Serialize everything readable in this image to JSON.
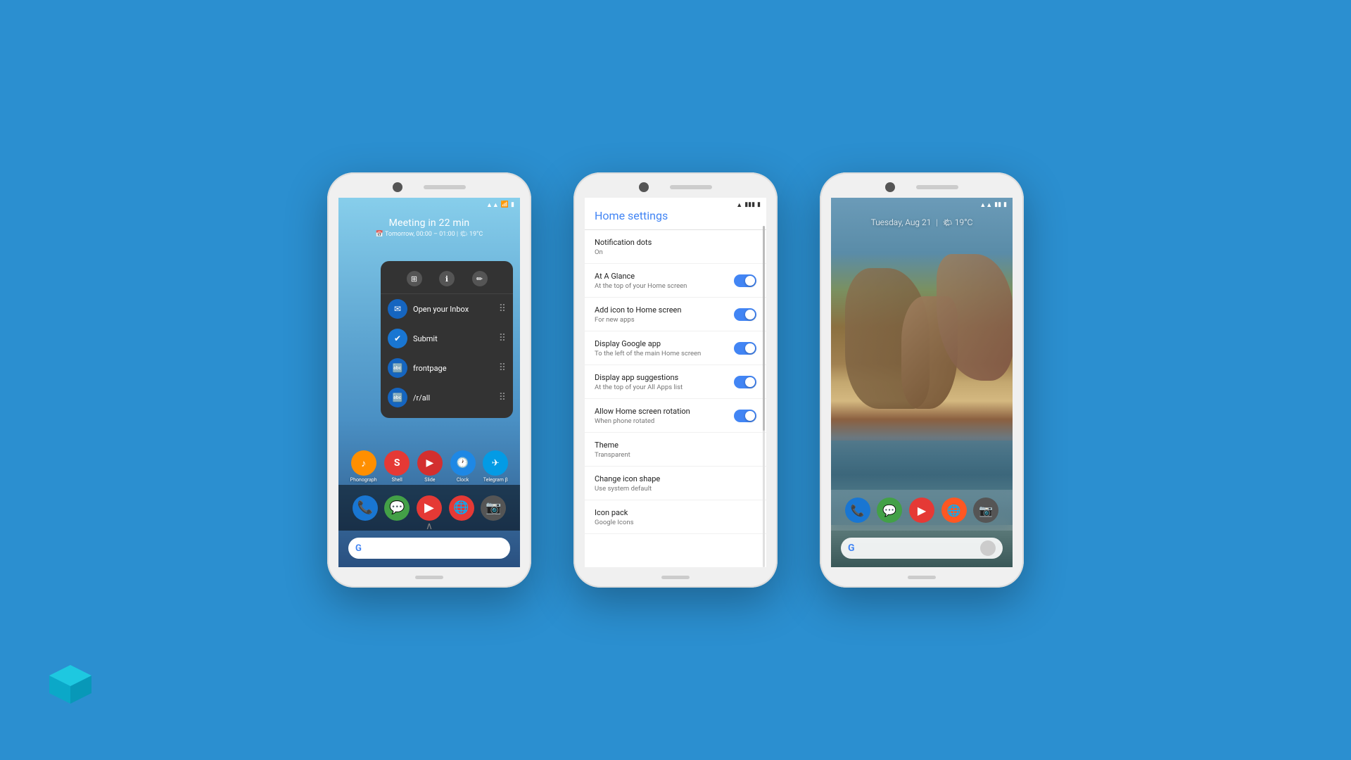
{
  "background": "#2B8FD0",
  "phone1": {
    "at_a_glance": {
      "title": "Meeting in 22 min",
      "detail": "📅 Tomorrow, 00:00 – 01:00 | 🌤 19°C"
    },
    "shortcuts_popup": {
      "items": [
        {
          "label": "Open your Inbox",
          "color": "#1565C0"
        },
        {
          "label": "Submit",
          "color": "#1976D2"
        },
        {
          "label": "frontpage",
          "color": "#1565C0"
        },
        {
          "label": "/r/all",
          "color": "#1565C0"
        }
      ]
    },
    "dock_apps": [
      "📞",
      "💬",
      "▶",
      "🌐",
      "📷"
    ],
    "home_apps": [
      {
        "label": "Phonograph",
        "emoji": "🎵",
        "color": "#FF8F00"
      },
      {
        "label": "Shell",
        "emoji": "S",
        "color": "#E53935"
      },
      {
        "label": "Slide",
        "emoji": "🔴",
        "color": "#D32F2F"
      },
      {
        "label": "Clock",
        "emoji": "🕐",
        "color": "#1E88E5"
      },
      {
        "label": "Telegram β",
        "emoji": "✈",
        "color": "#039BE5"
      }
    ],
    "search_placeholder": "G"
  },
  "phone2": {
    "title": "Home settings",
    "items": [
      {
        "title": "Notification dots",
        "subtitle": "On",
        "toggle": false,
        "has_toggle": false
      },
      {
        "title": "At A Glance",
        "subtitle": "At the top of your Home screen",
        "toggle": true,
        "has_toggle": true
      },
      {
        "title": "Add icon to Home screen",
        "subtitle": "For new apps",
        "toggle": true,
        "has_toggle": true
      },
      {
        "title": "Display Google app",
        "subtitle": "To the left of the main Home screen",
        "toggle": true,
        "has_toggle": true
      },
      {
        "title": "Display app suggestions",
        "subtitle": "At the top of your All Apps list",
        "toggle": true,
        "has_toggle": true
      },
      {
        "title": "Allow Home screen rotation",
        "subtitle": "When phone rotated",
        "toggle": true,
        "has_toggle": true
      },
      {
        "title": "Theme",
        "subtitle": "Transparent",
        "has_toggle": false
      },
      {
        "title": "Change icon shape",
        "subtitle": "Use system default",
        "has_toggle": false
      },
      {
        "title": "Icon pack",
        "subtitle": "Google Icons",
        "has_toggle": false
      }
    ]
  },
  "phone3": {
    "date": "Tuesday, Aug 21",
    "weather": "19°C",
    "dock_apps": [
      "📞",
      "💬",
      "▶",
      "🌐",
      "📷"
    ],
    "search_g": "G"
  },
  "logo": {
    "visible": true
  }
}
